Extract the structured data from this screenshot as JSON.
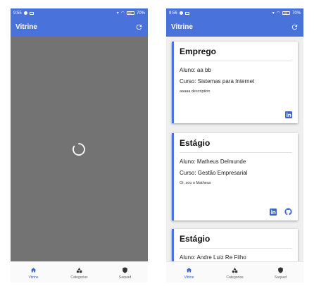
{
  "colors": {
    "primary": "#4a72db",
    "overlay": "#737373",
    "background": "#efefef"
  },
  "left": {
    "status": {
      "time": "9:55",
      "battery": "70%"
    },
    "appbar": {
      "title": "Vitrine",
      "refresh_icon": "refresh-icon"
    },
    "state": "loading"
  },
  "right": {
    "status": {
      "time": "9:56",
      "battery": "70%"
    },
    "appbar": {
      "title": "Vitrine",
      "refresh_icon": "refresh-icon"
    },
    "cards": [
      {
        "title": "Emprego",
        "student": "Aluno: aa bb",
        "course": "Curso: Sistemas para Internet",
        "description": "aaaaa description",
        "icons": [
          "linkedin-icon"
        ]
      },
      {
        "title": "Estágio",
        "student": "Aluno: Matheus Delmunde",
        "course": "Curso: Gestão Empresarial",
        "description": "Oi, sou o Matheus",
        "icons": [
          "linkedin-icon",
          "github-icon"
        ]
      },
      {
        "title": "Estágio",
        "student": "Aluno: Andre Luiz Re Filho"
      }
    ]
  },
  "nav": {
    "items": [
      {
        "label": "Vitrine",
        "icon": "home-icon",
        "active": true
      },
      {
        "label": "Categorias",
        "icon": "categories-icon",
        "active": false
      },
      {
        "label": "Saquad",
        "icon": "shield-icon",
        "active": false
      }
    ]
  }
}
